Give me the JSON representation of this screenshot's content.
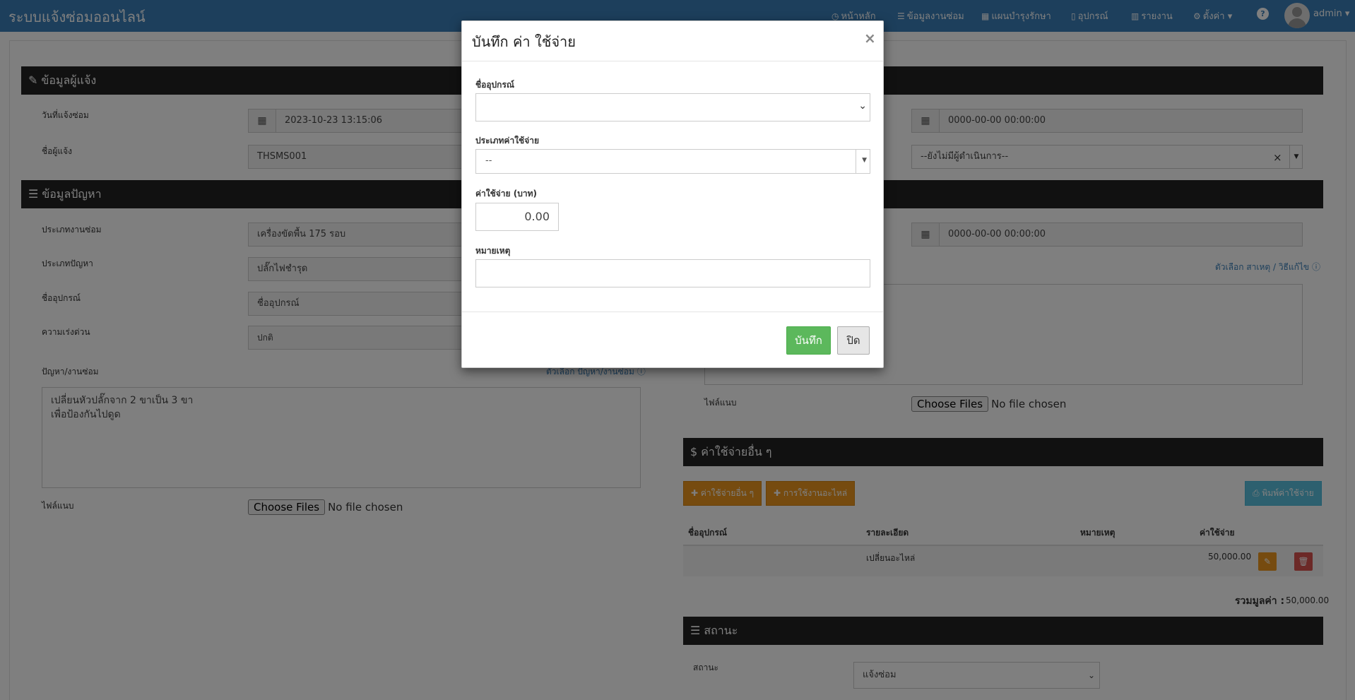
{
  "navbar": {
    "brand": "ระบบแจ้งซ่อมออนไลน์",
    "items": [
      {
        "icon": "clock-icon",
        "glyph": "◷",
        "label": "หน้าหลัก"
      },
      {
        "icon": "list-icon",
        "glyph": "☰",
        "label": "ข้อมูลงานซ่อม"
      },
      {
        "icon": "calendar-icon",
        "glyph": "▦",
        "label": "แผนบำรุงรักษา"
      },
      {
        "icon": "mobile-icon",
        "glyph": "▯",
        "label": "อุปกรณ์"
      },
      {
        "icon": "bar-chart-icon",
        "glyph": "▥",
        "label": "รายงาน"
      },
      {
        "icon": "gear-icon",
        "glyph": "⚙",
        "label": "ตั้งค่า"
      }
    ],
    "help_glyph": "?",
    "user": "admin"
  },
  "page": {
    "reporter_section": "ข้อมูลผู้แจ้ง",
    "date_label": "วันที่แจ้งซ่อม",
    "date_value": "2023-10-23 13:15:06",
    "reporter_label": "ชื่อผู้แจ้ง",
    "reporter_value": "THSMS001",
    "right_date1": "0000-00-00 00:00:00",
    "right_assignee": "--ยังไม่มีผู้ดำเนินการ--",
    "problem_section": "ข้อมูลปัญหา",
    "job_type_label": "ประเภทงานซ่อม",
    "job_type_value": "เครื่องขัดพื้น 175 รอบ",
    "problem_type_label": "ประเภทปัญหา",
    "problem_type_value": "ปลั๊กไฟชำรุด",
    "device_label": "ชื่ออุปกรณ์",
    "device_value": "ชื่ออุปกรณ์",
    "urgency_label": "ความเร่งด่วน",
    "urgency_value": "ปกติ",
    "issue_label": "ปัญหา/งานซ่อม",
    "issue_option_link": "ตัวเลือก ปัญหา/งานซ่อม",
    "issue_text_line1": "เปลี่ยนหัวปลั๊กจาก 2 ขาเป็น 3 ขา",
    "issue_text_line2": "เพื่อป้องกันไปดูด",
    "attach_label": "ไฟล์แนบ",
    "file_button": "Choose Files",
    "no_file": "No file chosen",
    "right_date2": "0000-00-00 00:00:00",
    "cause_option_link": "ตัวเลือก สาเหตุ / วิธีแก้ไข",
    "right_attach_label": "ไฟล์แนบ",
    "expense_section": "ค่าใช้จ่ายอื่น ๆ",
    "btn_add_expense": "ค่าใช้จ่ายอื่น ๆ",
    "btn_add_parts": "การใช้งานอะไหล่",
    "btn_print": "พิมพ์ค่าใช้จ่าย",
    "table_headers": [
      "ชื่ออุปกรณ์",
      "รายละเอียด",
      "หมายเหตุ",
      "ค่าใช้จ่าย"
    ],
    "table_row": {
      "detail": "เปลี่ยนอะไหล่",
      "cost": "50,000.00"
    },
    "total_label": "รวมมูลค่า :",
    "total_value": "50,000.00",
    "status_section": "สถานะ",
    "status_label": "สถานะ",
    "status_value": "แจ้งซ่อม"
  },
  "modal": {
    "title": "บันทึก ค่า ใช้จ่าย",
    "close_glyph": "×",
    "device_label": "ชื่ออุปกรณ์",
    "device_value": "",
    "expense_type_label": "ประเภทค่าใช้จ่าย",
    "expense_type_value": "--",
    "amount_label": "ค่าใช้จ่าย (บาท)",
    "amount_value": "0.00",
    "note_label": "หมายเหตุ",
    "note_value": "",
    "save_button": "บันทึก",
    "close_button": "ปิด"
  },
  "colors": {
    "navbar": "#3a7fb8",
    "section_bar": "#222222",
    "save_green": "#5cb85c",
    "warning_orange": "#ec971f",
    "info_blue": "#5bc0de",
    "danger_red": "#d9534f"
  }
}
